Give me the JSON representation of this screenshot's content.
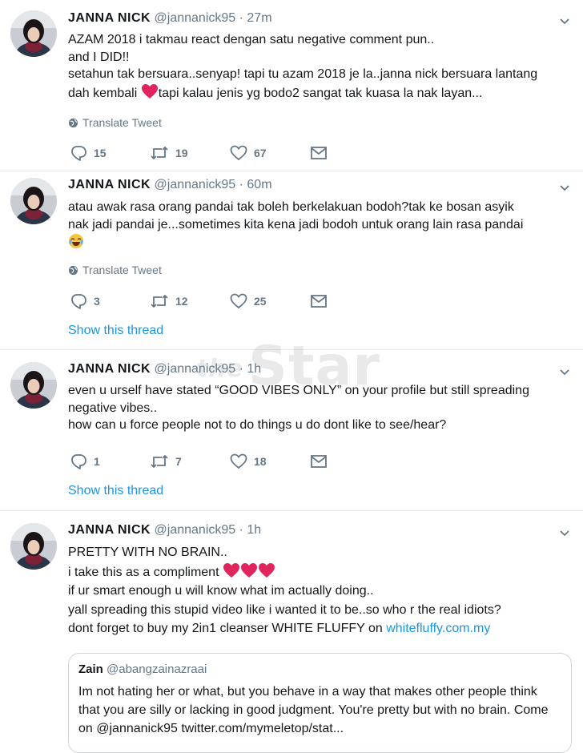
{
  "colors": {
    "accent": "#1b95e0",
    "muted": "#657786",
    "heart": "#e0245e",
    "divider": "#e6ecf0"
  },
  "watermark": {
    "prefix": "the",
    "text": "Star"
  },
  "tweets": [
    {
      "name": "JANNA NICK",
      "handle": "@jannanick95",
      "sep": "·",
      "time": "27m",
      "lines": [
        "AZAM 2018 i takmau react dengan satu negative comment pun..",
        "and I DID!!",
        "setahun tak bersuara..senyap! tapi tu azam 2018 je la..janna nick bersuara lantang",
        "dah kembali",
        "tapi kalau jenis yg bodo2 sangat tak kuasa la nak layan..."
      ],
      "translate": "Translate Tweet",
      "replies": "15",
      "retweets": "19",
      "likes": "67"
    },
    {
      "name": "JANNA NICK",
      "handle": "@jannanick95",
      "sep": "·",
      "time": "60m",
      "lines": [
        "atau awak rasa orang pandai tak boleh berkelakuan bodoh?tak ke bosan asyik",
        "nak jadi pandai je...sometimes kita kena jadi bodoh untuk orang lain rasa pandai"
      ],
      "translate": "Translate Tweet",
      "replies": "3",
      "retweets": "12",
      "likes": "25",
      "show_thread": "Show this thread"
    },
    {
      "name": "JANNA NICK",
      "handle": "@jannanick95",
      "sep": "·",
      "time": "1h",
      "lines": [
        "even u urself have stated “GOOD VIBES ONLY” on your profile but still spreading",
        "negative vibes..",
        "how can u force people not to do things u do dont like to see/hear?"
      ],
      "replies": "1",
      "retweets": "7",
      "likes": "18",
      "show_thread": "Show this thread"
    },
    {
      "name": "JANNA NICK",
      "handle": "@jannanick95",
      "sep": "·",
      "time": "1h",
      "lines": [
        "PRETTY WITH NO BRAIN..",
        "i take this as a compliment",
        "if ur smart enough u will know what im actually doing..",
        "yall spreading this stupid video like i wanted it to be..so who r the real idiots?",
        "dont forget to buy my 2in1 cleanser WHITE FLUFFY on "
      ],
      "link": "whitefluffy.com.my",
      "quote": {
        "name": "Zain",
        "handle": "@abangzainazraai",
        "text": "Im not hating her or what, but you behave in a way that makes other people think that you are silly or lacking in good judgment. You're pretty but with no brain. Come on @jannanick95 twitter.com/mymeletop/stat..."
      }
    }
  ]
}
